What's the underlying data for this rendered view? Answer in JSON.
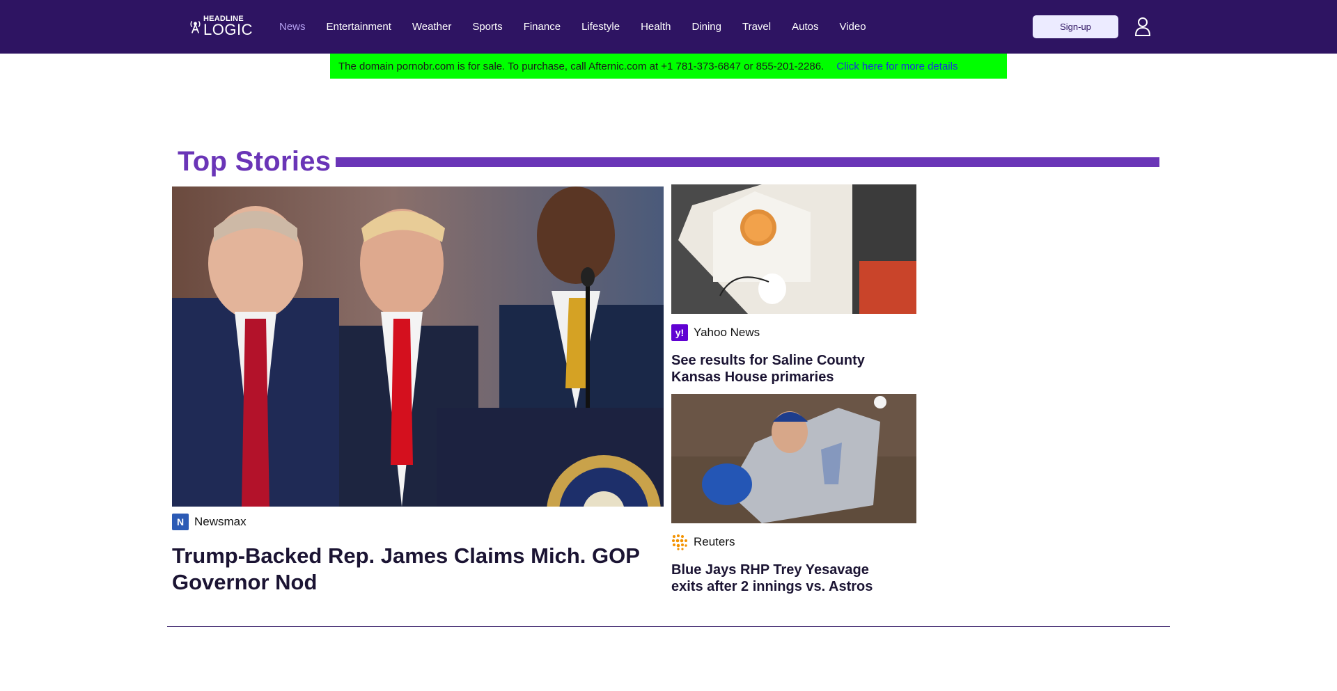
{
  "brand": {
    "line1": "HEADLINE",
    "line2": "LOGIC"
  },
  "nav": {
    "items": [
      {
        "label": "News",
        "active": true
      },
      {
        "label": "Entertainment"
      },
      {
        "label": "Weather"
      },
      {
        "label": "Sports"
      },
      {
        "label": "Finance"
      },
      {
        "label": "Lifestyle"
      },
      {
        "label": "Health"
      },
      {
        "label": "Dining"
      },
      {
        "label": "Travel"
      },
      {
        "label": "Autos"
      },
      {
        "label": "Video"
      }
    ]
  },
  "header": {
    "signup_label": "Sign-up",
    "user_icon": "user-icon"
  },
  "banner": {
    "message": "The domain pornobr.com is for sale. To purchase, call Afternic.com at +1 781-373-6847 or 855-201-2286.",
    "link": "Click here for more details"
  },
  "section": {
    "title": "Top Stories"
  },
  "stories": {
    "main": {
      "source": "Newsmax",
      "source_badge": "N",
      "headline": "Trump-Backed Rep. James Claims Mich. GOP Governor Nod"
    },
    "side1": {
      "source": "Yahoo News",
      "source_badge": "y!",
      "headline": "See results for Saline County Kansas House primaries"
    },
    "side2": {
      "source": "Reuters",
      "headline": "Blue Jays RHP Trey Yesavage exits after 2 innings vs. Astros"
    }
  },
  "colors": {
    "header_bg": "#2e1462",
    "accent": "#6a35b7",
    "nav_active": "#b6a2f2",
    "banner_bg": "#00ff00",
    "banner_link": "#1b2ee0"
  }
}
